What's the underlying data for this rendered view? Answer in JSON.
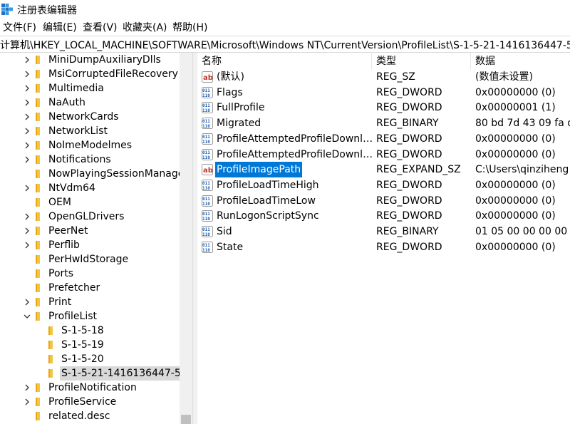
{
  "window": {
    "title": "注册表编辑器"
  },
  "menu": [
    "文件(F)",
    "编辑(E)",
    "查看(V)",
    "收藏夹(A)",
    "帮助(H)"
  ],
  "address": "计算机\\HKEY_LOCAL_MACHINE\\SOFTWARE\\Microsoft\\Windows NT\\CurrentVersion\\ProfileList\\S-1-5-21-1416136447-58",
  "tree": [
    {
      "label": "MiniDumpAuxiliaryDlls",
      "level": 0,
      "expand": "collapsed"
    },
    {
      "label": "MsiCorruptedFileRecovery",
      "level": 0,
      "expand": "collapsed"
    },
    {
      "label": "Multimedia",
      "level": 0,
      "expand": "collapsed"
    },
    {
      "label": "NaAuth",
      "level": 0,
      "expand": "collapsed"
    },
    {
      "label": "NetworkCards",
      "level": 0,
      "expand": "collapsed"
    },
    {
      "label": "NetworkList",
      "level": 0,
      "expand": "collapsed"
    },
    {
      "label": "NoImeModelmes",
      "level": 0,
      "expand": "collapsed"
    },
    {
      "label": "Notifications",
      "level": 0,
      "expand": "collapsed"
    },
    {
      "label": "NowPlayingSessionManage",
      "level": 0,
      "expand": "none"
    },
    {
      "label": "NtVdm64",
      "level": 0,
      "expand": "collapsed"
    },
    {
      "label": "OEM",
      "level": 0,
      "expand": "none"
    },
    {
      "label": "OpenGLDrivers",
      "level": 0,
      "expand": "collapsed"
    },
    {
      "label": "PeerNet",
      "level": 0,
      "expand": "collapsed"
    },
    {
      "label": "Perflib",
      "level": 0,
      "expand": "collapsed"
    },
    {
      "label": "PerHwIdStorage",
      "level": 0,
      "expand": "none"
    },
    {
      "label": "Ports",
      "level": 0,
      "expand": "none"
    },
    {
      "label": "Prefetcher",
      "level": 0,
      "expand": "none"
    },
    {
      "label": "Print",
      "level": 0,
      "expand": "collapsed"
    },
    {
      "label": "ProfileList",
      "level": 0,
      "expand": "expanded"
    },
    {
      "label": "S-1-5-18",
      "level": 1,
      "expand": "none"
    },
    {
      "label": "S-1-5-19",
      "level": 1,
      "expand": "none"
    },
    {
      "label": "S-1-5-20",
      "level": 1,
      "expand": "none"
    },
    {
      "label": "S-1-5-21-1416136447-5",
      "level": 1,
      "expand": "none",
      "selected": true
    },
    {
      "label": "ProfileNotification",
      "level": 0,
      "expand": "collapsed"
    },
    {
      "label": "ProfileService",
      "level": 0,
      "expand": "collapsed"
    },
    {
      "label": "related.desc",
      "level": 0,
      "expand": "none"
    }
  ],
  "columns": {
    "name": "名称",
    "type": "类型",
    "data": "数据"
  },
  "values": [
    {
      "name": "(默认)",
      "type": "REG_SZ",
      "data": "(数值未设置)",
      "icon": "string"
    },
    {
      "name": "Flags",
      "type": "REG_DWORD",
      "data": "0x00000000 (0)",
      "icon": "binary"
    },
    {
      "name": "FullProfile",
      "type": "REG_DWORD",
      "data": "0x00000001 (1)",
      "icon": "binary"
    },
    {
      "name": "Migrated",
      "type": "REG_BINARY",
      "data": "80 bd 7d 43 09 fa d",
      "icon": "binary"
    },
    {
      "name": "ProfileAttemptedProfileDownlo...",
      "type": "REG_DWORD",
      "data": "0x00000000 (0)",
      "icon": "binary"
    },
    {
      "name": "ProfileAttemptedProfileDownlo...",
      "type": "REG_DWORD",
      "data": "0x00000000 (0)",
      "icon": "binary"
    },
    {
      "name": "ProfileImagePath",
      "type": "REG_EXPAND_SZ",
      "data": "C:\\Users\\qinziheng",
      "icon": "string",
      "selected": true
    },
    {
      "name": "ProfileLoadTimeHigh",
      "type": "REG_DWORD",
      "data": "0x00000000 (0)",
      "icon": "binary"
    },
    {
      "name": "ProfileLoadTimeLow",
      "type": "REG_DWORD",
      "data": "0x00000000 (0)",
      "icon": "binary"
    },
    {
      "name": "RunLogonScriptSync",
      "type": "REG_DWORD",
      "data": "0x00000000 (0)",
      "icon": "binary"
    },
    {
      "name": "Sid",
      "type": "REG_BINARY",
      "data": "01 05 00 00 00 00 0",
      "icon": "binary"
    },
    {
      "name": "State",
      "type": "REG_DWORD",
      "data": "0x00000000 (0)",
      "icon": "binary"
    }
  ],
  "colors": {
    "selection": "#0078d7",
    "tree_selection": "#d9d9d9",
    "folder": "#f4c542"
  }
}
